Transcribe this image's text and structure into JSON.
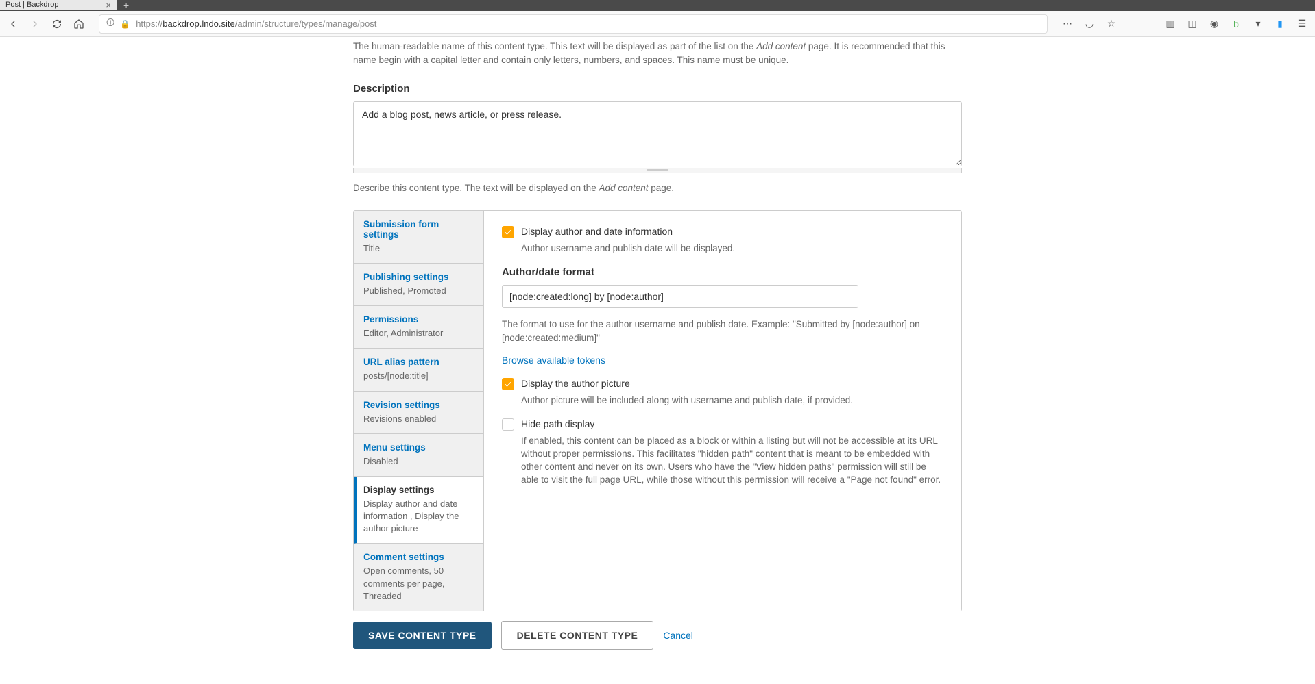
{
  "browser": {
    "tab_title": "Post | Backdrop",
    "url_prefix": "https://",
    "url_domain": "backdrop.lndo.site",
    "url_path": "/admin/structure/types/manage/post"
  },
  "intro_help": {
    "line1_a": "The human-readable name of this content type. This text will be displayed as part of the list on the ",
    "line1_em": "Add content",
    "line1_b": " page. It is recommended that this name begin with a capital letter and contain only letters, numbers, and spaces. This name must be unique."
  },
  "description": {
    "label": "Description",
    "value": "Add a blog post, news article, or press release.",
    "help_a": "Describe this content type. The text will be displayed on the ",
    "help_em": "Add content",
    "help_b": " page."
  },
  "tabs": [
    {
      "title": "Submission form settings",
      "summary": "Title"
    },
    {
      "title": "Publishing settings",
      "summary": "Published, Promoted"
    },
    {
      "title": "Permissions",
      "summary": "Editor, Administrator"
    },
    {
      "title": "URL alias pattern",
      "summary": "posts/[node:title]"
    },
    {
      "title": "Revision settings",
      "summary": "Revisions enabled"
    },
    {
      "title": "Menu settings",
      "summary": "Disabled"
    },
    {
      "title": "Display settings",
      "summary": "Display author and date information , Display the author picture"
    },
    {
      "title": "Comment settings",
      "summary": "Open comments, 50 comments per page, Threaded"
    }
  ],
  "display": {
    "author_date_label": "Display author and date information",
    "author_date_help": "Author username and publish date will be displayed.",
    "format_label": "Author/date format",
    "format_value": "[node:created:long] by [node:author]",
    "format_help": "The format to use for the author username and publish date. Example: \"Submitted by [node:author] on [node:created:medium]\"",
    "tokens_link": "Browse available tokens",
    "author_pic_label": "Display the author picture",
    "author_pic_help": "Author picture will be included along with username and publish date, if provided.",
    "hide_path_label": "Hide path display",
    "hide_path_help": "If enabled, this content can be placed as a block or within a listing but will not be accessible at its URL without proper permissions. This facilitates \"hidden path\" content that is meant to be embedded with other content and never on its own. Users who have the \"View hidden paths\" permission will still be able to visit the full page URL, while those without this permission will receive a \"Page not found\" error."
  },
  "actions": {
    "save": "Save content type",
    "delete": "Delete content type",
    "cancel": "Cancel"
  }
}
